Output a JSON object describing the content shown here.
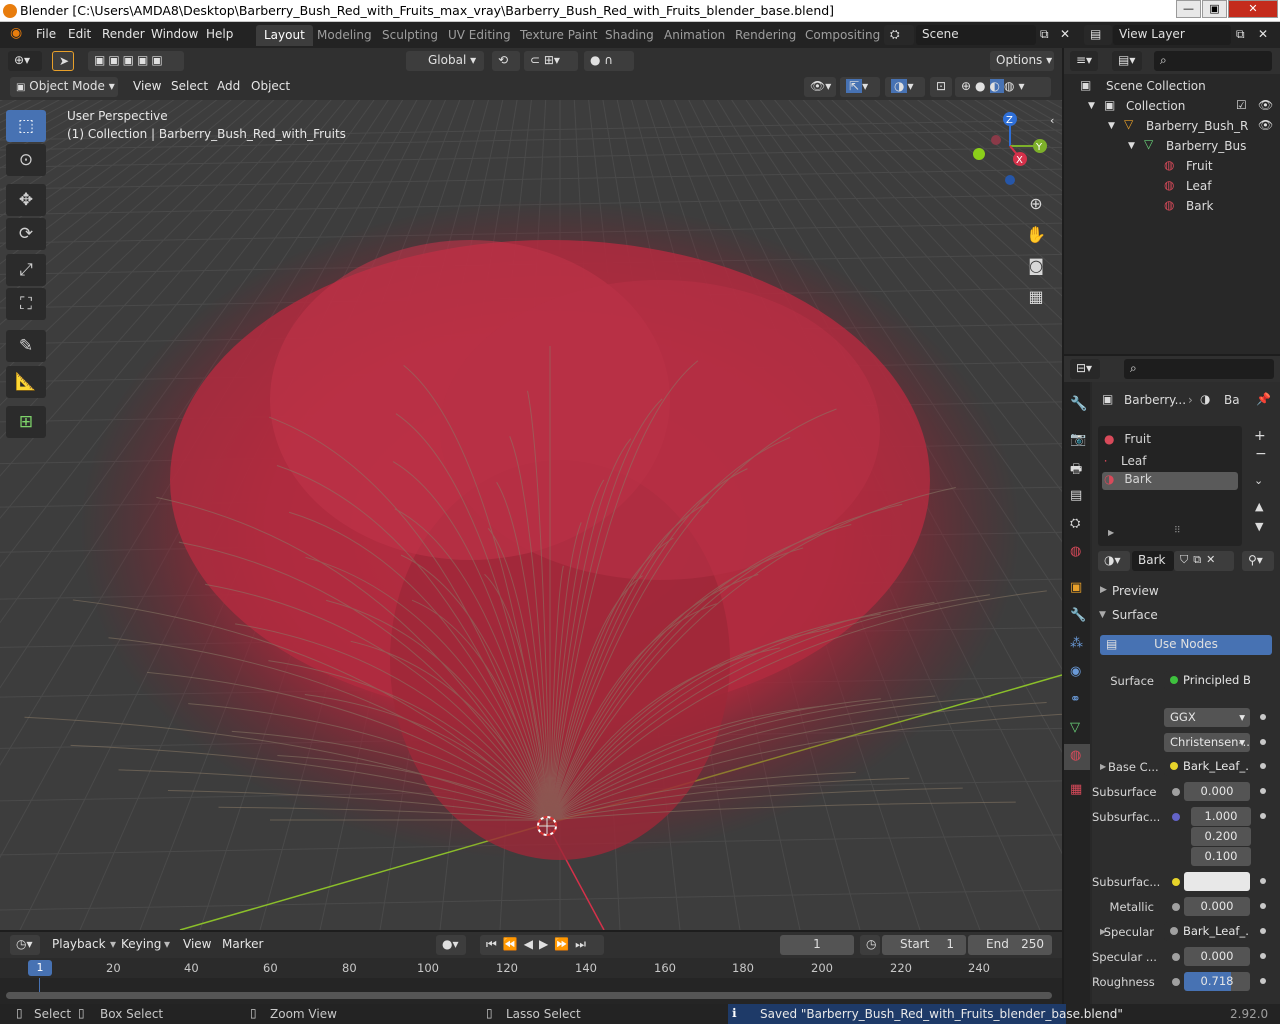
{
  "window": {
    "title": "Blender [C:\\Users\\AMDA8\\Desktop\\Barberry_Bush_Red_with_Fruits_max_vray\\Barberry_Bush_Red_with_Fruits_blender_base.blend]"
  },
  "menu": [
    "File",
    "Edit",
    "Render",
    "Window",
    "Help"
  ],
  "workspaces": [
    "Layout",
    "Modeling",
    "Sculpting",
    "UV Editing",
    "Texture Paint",
    "Shading",
    "Animation",
    "Rendering",
    "Compositing"
  ],
  "scene": {
    "name": "Scene",
    "view_layer": "View Layer"
  },
  "toolbar": {
    "orientation": "Global",
    "options": "Options"
  },
  "viewport_header": {
    "mode": "Object Mode",
    "menus": [
      "View",
      "Select",
      "Add",
      "Object"
    ]
  },
  "viewport": {
    "perspective": "User Perspective",
    "collection_info": "(1) Collection | Barberry_Bush_Red_with_Fruits"
  },
  "gizmo": {
    "z": "Z",
    "y": "Y",
    "x": "X"
  },
  "outliner": {
    "root": "Scene Collection",
    "items": [
      "Collection",
      "Barberry_Bush_R",
      "Barberry_Bus",
      "Fruit",
      "Leaf",
      "Bark"
    ]
  },
  "properties": {
    "object_name": "Barberry...",
    "material_short": "Ba",
    "slots": [
      "Fruit",
      "Leaf",
      "Bark"
    ],
    "active_material": "Bark",
    "panels": {
      "preview": "Preview",
      "surface": "Surface"
    },
    "use_nodes": "Use Nodes",
    "rows": {
      "surface_label": "Surface",
      "surface_value": "Principled B...",
      "distribution": "GGX",
      "subsurface_method": "Christensen-...",
      "base_color_label": "Base C...",
      "base_color_value": "Bark_Leaf_...",
      "subsurface_label": "Subsurface",
      "subsurface_value": "0.000",
      "subsurface_radius_label": "Subsurfac...",
      "radius": [
        "1.000",
        "0.200",
        "0.100"
      ],
      "subsurface_color_label": "Subsurfac...",
      "metallic_label": "Metallic",
      "metallic_value": "0.000",
      "specular_label": "Specular",
      "specular_value": "Bark_Leaf_...",
      "specular_tint_label": "Specular ...",
      "specular_tint_value": "0.000",
      "roughness_label": "Roughness",
      "roughness_value": "0.718"
    },
    "roughness_fraction": 0.718
  },
  "timeline": {
    "menus": [
      "Playback",
      "Keying",
      "View",
      "Marker"
    ],
    "current_frame": "1",
    "start_label": "Start",
    "start": "1",
    "end_label": "End",
    "end": "250",
    "ticks": [
      "1",
      "20",
      "40",
      "60",
      "80",
      "100",
      "120",
      "140",
      "160",
      "180",
      "200",
      "220",
      "240"
    ]
  },
  "status": {
    "select": "Select",
    "box_select": "Box Select",
    "zoom_view": "Zoom View",
    "lasso_select": "Lasso Select",
    "message": "Saved \"Barberry_Bush_Red_with_Fruits_blender_base.blend\"",
    "version": "2.92.0"
  },
  "colors": {
    "accent": "#4772b3",
    "bush": "#b3283a",
    "grid": "#4a4a4a",
    "y_axis": "#8bbf2a",
    "x_axis": "#d4314a"
  }
}
